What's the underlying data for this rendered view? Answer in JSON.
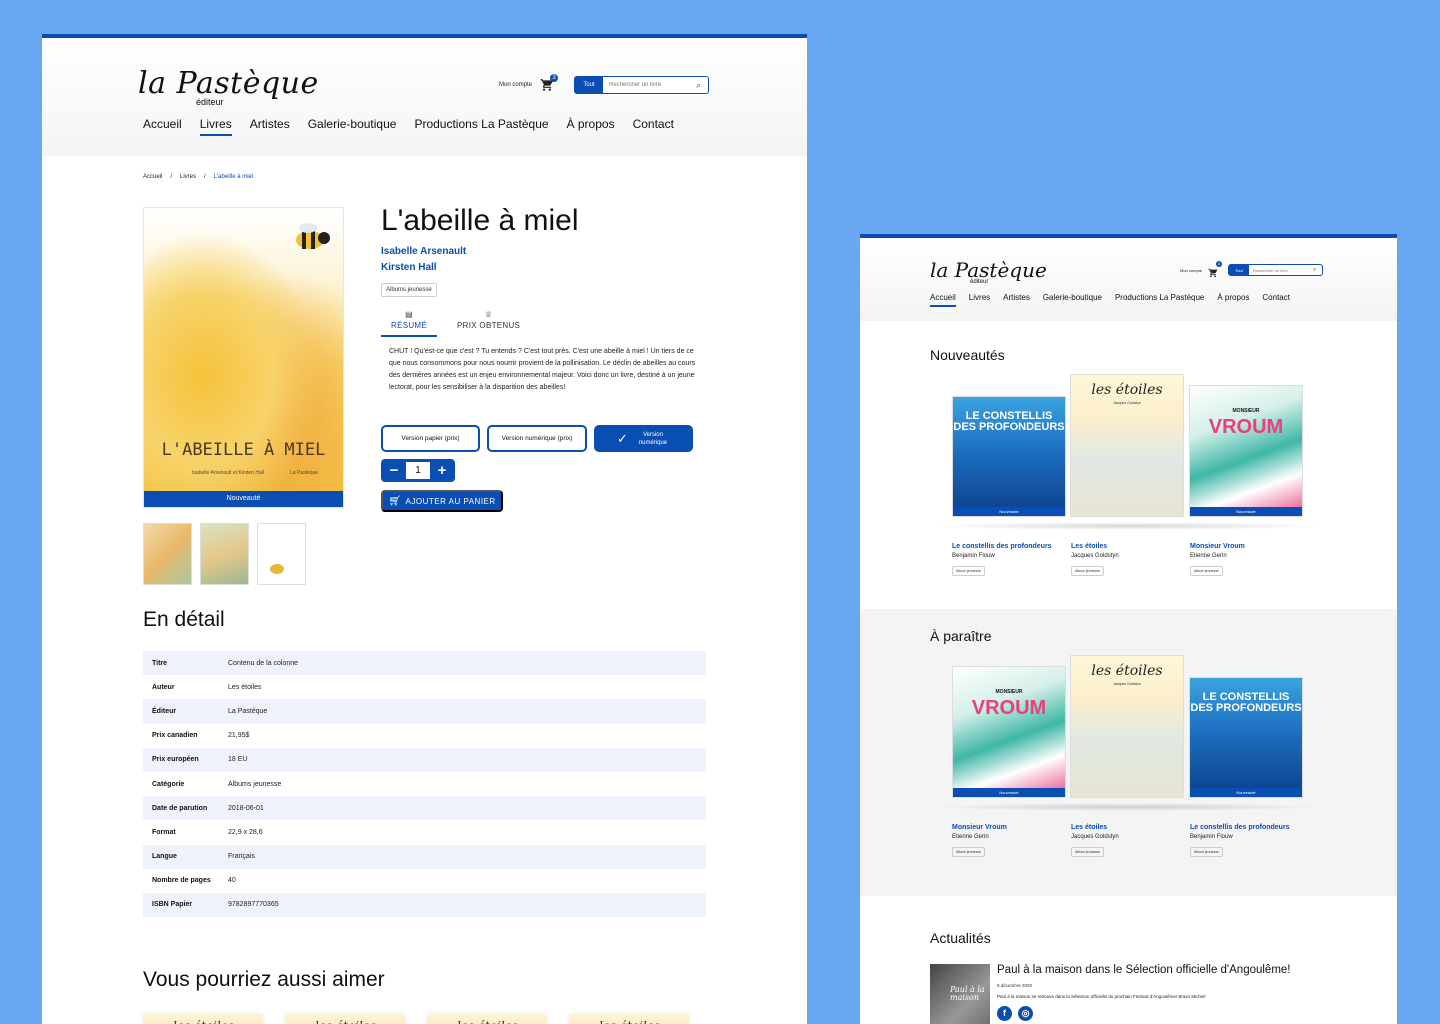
{
  "brand": {
    "logo": "la Pastèque",
    "sub": "éditeur"
  },
  "header": {
    "account": "Mon compte",
    "cart_count": "3",
    "search_scope": "Tout",
    "search_placeholder": "Rechercher un livre"
  },
  "nav": [
    "Accueil",
    "Livres",
    "Artistes",
    "Galerie-boutique",
    "Productions La Pastèque",
    "À propos",
    "Contact"
  ],
  "breadcrumb": [
    "Accueil",
    "/",
    "Livres",
    "/",
    "L'abeille à miel"
  ],
  "product": {
    "title": "L'abeille à miel",
    "authors": [
      "Isabelle Arsenault",
      "Kirsten Hall"
    ],
    "category_tag": "Albums jeunesse",
    "cover_title": "L'ABEILLE À MIEL",
    "cover_authors": "Isabelle Arsenault et Kirsten Hall",
    "cover_publisher": "La Pastèque",
    "ribbon": "Nouveauté",
    "tabs": [
      "RÉSUMÉ",
      "PRIX OBTENUS"
    ],
    "summary": "CHUT ! Qu'est-ce que c'est ? Tu entends ? C'est tout près. C'est une abeille à miel ! Un tiers de ce que nous consommons pour nous nourrir provient de la pollinisation. Le déclin de abeilles au cours des dernières années est un enjeu environnemental majeur. Voici donc un livre, destiné à un jeune lectorat, pour les sensibiliser à la disparition des abeilles!",
    "btn_paper": "Version papier (prix)",
    "btn_digital": "Version numérique (prix)",
    "btn_digital_active": "Version numérique",
    "qty_minus": "−",
    "qty": "1",
    "qty_plus": "+",
    "add_to_cart": "AJOUTER AU PANIER"
  },
  "details": {
    "heading": "En détail",
    "rows": [
      {
        "k": "Titre",
        "v": "Contenu de la colonne"
      },
      {
        "k": "Auteur",
        "v": "Les étoiles"
      },
      {
        "k": "Éditeur",
        "v": "La Pastèque"
      },
      {
        "k": "Prix canadien",
        "v": "21,95$"
      },
      {
        "k": "Prix européen",
        "v": "18 EU"
      },
      {
        "k": "Catégorie",
        "v": "Albums jeunesse"
      },
      {
        "k": "Date de parution",
        "v": "2018-06-01"
      },
      {
        "k": "Format",
        "v": "22,9 x 28,6"
      },
      {
        "k": "Langue",
        "v": "Français"
      },
      {
        "k": "Nombre de pages",
        "v": "40"
      },
      {
        "k": "ISBN Papier",
        "v": "9782897770365"
      }
    ]
  },
  "similar": {
    "heading": "Vous pourriez aussi aimer"
  },
  "home": {
    "new_heading": "Nouveautés",
    "upcoming_heading": "À paraître",
    "news_heading": "Actualités",
    "ribbon": "Nouveauté",
    "new_books": [
      {
        "title": "Le constellis des profondeurs",
        "author": "Benjamin Flouw",
        "tag": "Album jeunesse",
        "cover": "LE CONSTELLIS DES PROFONDEURS"
      },
      {
        "title": "Les étoiles",
        "author": "Jacques Goldstyn",
        "tag": "Album jeunesse",
        "cover": "les étoiles",
        "cover_sub": "Jacques Goldstyn"
      },
      {
        "title": "Monsieur Vroum",
        "author": "Etienne Gerin",
        "tag": "Album jeunesse",
        "cover": "MONSIEUR",
        "cover_big": "VROUM"
      }
    ],
    "upcoming_books": [
      {
        "title": "Monsieur Vroum",
        "author": "Etienne Gerin",
        "tag": "Album jeunesse",
        "cover": "MONSIEUR",
        "cover_big": "VROUM"
      },
      {
        "title": "Les étoiles",
        "author": "Jacques Goldstyn",
        "tag": "Album jeunesse",
        "cover": "les étoiles",
        "cover_sub": "Jacques Goldstyn"
      },
      {
        "title": "Le constellis des profondeurs",
        "author": "Benjamin Flouw",
        "tag": "Album jeunesse",
        "cover": "LE CONSTELLIS DES PROFONDEURS"
      }
    ],
    "news": {
      "title": "Paul à la maison dans le Sélection officielle d'Angoulême!",
      "date": "9 décembre 2020",
      "excerpt": "Paul à la maison se retrouve dans la Sélection officielle du prochain Festival d'Angoulême! Bravo Michel!",
      "image_text": "Paul à la maison",
      "social": [
        "f",
        "◎"
      ]
    }
  },
  "colors": {
    "brand_blue": "#0a4db3",
    "background": "#6aa7f2"
  }
}
